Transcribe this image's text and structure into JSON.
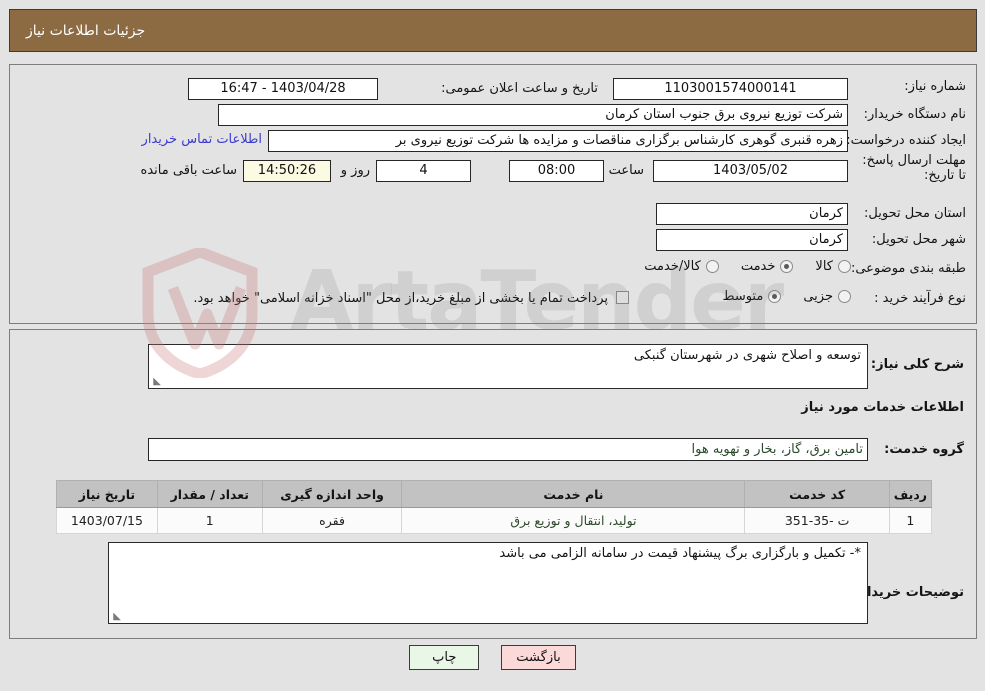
{
  "header": {
    "title": "جزئیات اطلاعات نیاز"
  },
  "form": {
    "need_number_label": "شماره نیاز:",
    "need_number_value": "1103001574000141",
    "announce_datetime_label": "تاریخ و ساعت اعلان عمومی:",
    "announce_datetime_value": "1403/04/28 - 16:47",
    "buyer_org_label": "نام دستگاه خریدار:",
    "buyer_org_value": "شرکت توزیع نیروی برق جنوب استان کرمان",
    "creator_label": "ایجاد کننده درخواست:",
    "creator_value": "زهره قنبری گوهری کارشناس برگزاری مناقصات و مزایده ها شرکت توزیع نیروی بر",
    "contact_link": "اطلاعات تماس خریدار",
    "deadline_label": "مهلت ارسال پاسخ: تا تاریخ:",
    "deadline_date": "1403/05/02",
    "deadline_hour_label": "ساعت",
    "deadline_hour": "08:00",
    "remaining_days": "4",
    "remaining_days_label": "روز و",
    "remaining_time": "14:50:26",
    "remaining_time_label": "ساعت باقی مانده",
    "province_label": "استان محل تحویل:",
    "province_value": "کرمان",
    "city_label": "شهر محل تحویل:",
    "city_value": "کرمان",
    "category_label": "طبقه بندی موضوعی:",
    "category_options": [
      {
        "label": "کالا",
        "selected": false
      },
      {
        "label": "خدمت",
        "selected": true
      },
      {
        "label": "کالا/خدمت",
        "selected": false
      }
    ],
    "process_label": "نوع فرآیند خرید :",
    "process_options": [
      {
        "label": "جزیی",
        "selected": false
      },
      {
        "label": "متوسط",
        "selected": true
      }
    ],
    "treasury_checkbox_checked": false,
    "treasury_text": "پرداخت تمام یا بخشی از مبلغ خرید،از محل \"اسناد خزانه اسلامی\" خواهد بود."
  },
  "description": {
    "label": "شرح کلی نیاز:",
    "value": "توسعه و اصلاح شهری در شهرستان گنبکی"
  },
  "services": {
    "section_title": "اطلاعات خدمات مورد نیاز",
    "group_label": "گروه خدمت:",
    "group_value": "تامین برق، گاز، بخار و تهویه هوا",
    "table": {
      "headers": [
        "ردیف",
        "کد خدمت",
        "نام خدمت",
        "واحد اندازه گیری",
        "تعداد / مقدار",
        "تاریخ نیاز"
      ],
      "rows": [
        [
          "1",
          "ت -35-351",
          "تولید، انتقال و توزیع برق",
          "فقره",
          "1",
          "1403/07/15"
        ]
      ]
    }
  },
  "buyer_notes": {
    "label": "توضیحات خریدار:",
    "value": "*- تکمیل و بارگزاری برگ پیشنهاد قیمت در سامانه الزامی می باشد"
  },
  "footer": {
    "print_label": "چاپ",
    "back_label": "بازگشت"
  },
  "watermark": {
    "text": "ArtaTender"
  },
  "colors": {
    "header_bg": "#8c6b42",
    "page_bg": "#e3e3e3",
    "link": "#3a3ad0",
    "print_btn": "#e9f7e7",
    "back_btn": "#fcd9d9",
    "table_header": "#c2c2c2"
  }
}
